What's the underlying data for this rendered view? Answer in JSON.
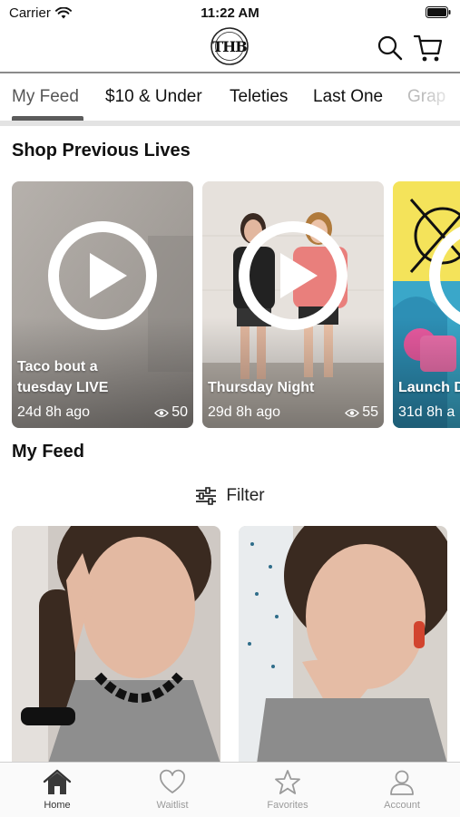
{
  "status_bar": {
    "carrier": "Carrier",
    "time": "11:22 AM"
  },
  "header": {
    "logo_text": "THB",
    "logo_icon": "thb-logo",
    "search_icon": "search-icon",
    "cart_icon": "cart-icon"
  },
  "tabs": [
    {
      "label": "My Feed",
      "active": true
    },
    {
      "label": "$10 & Under"
    },
    {
      "label": "Teleties"
    },
    {
      "label": "Last One"
    },
    {
      "label": "Grap"
    }
  ],
  "previous_lives": {
    "title": "Shop Previous Lives",
    "items": [
      {
        "title_line1": "Taco bout a",
        "title_line2": "tuesday LIVE",
        "ago": "24d 8h ago",
        "views": "50"
      },
      {
        "title_line1": "Thursday Night",
        "title_line2": "",
        "ago": "29d 8h ago",
        "views": "55"
      },
      {
        "title_line1": "Launch D",
        "title_line2": "",
        "ago": "31d 8h a",
        "views": ""
      }
    ]
  },
  "feed": {
    "title": "My Feed",
    "filter_label": "Filter",
    "filter_icon": "sliders-icon"
  },
  "colors": {
    "accent": "#5c5c5c",
    "nav_inactive": "#9a9a9a"
  },
  "bottom_nav": [
    {
      "label": "Home",
      "icon": "home-icon",
      "active": true
    },
    {
      "label": "Waitlist",
      "icon": "heart-icon"
    },
    {
      "label": "Favorites",
      "icon": "star-icon"
    },
    {
      "label": "Account",
      "icon": "person-icon"
    }
  ]
}
